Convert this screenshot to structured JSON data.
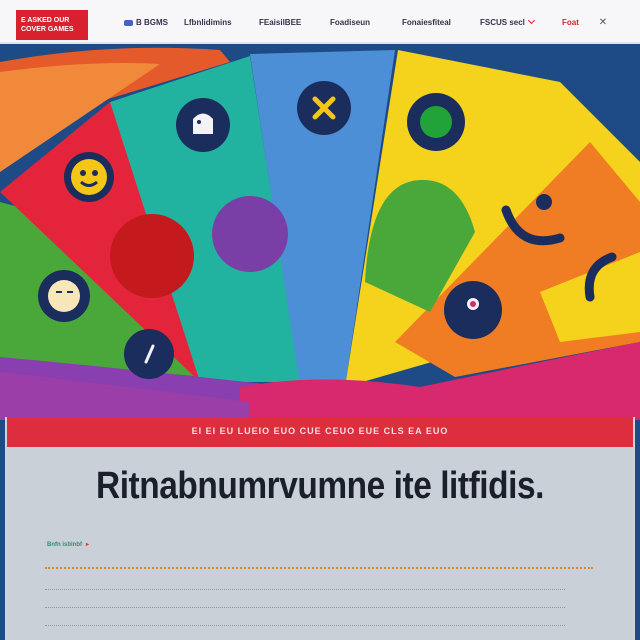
{
  "header": {
    "logo_text": "E ASKED OUR\nCOVER GAMES",
    "nav": [
      {
        "label": "B BGMS",
        "icon": "flag-icon"
      },
      {
        "label": "Lfbnlidimins"
      },
      {
        "label": "FEaisilBEE"
      },
      {
        "label": "Foadiseun"
      },
      {
        "label": "Fonaiesfiteal"
      },
      {
        "label": "FSCUS secl",
        "icon": "chevron-down-icon"
      },
      {
        "label": "Foat",
        "accent": true
      }
    ],
    "close_icon": "close-icon"
  },
  "hero": {
    "palette": {
      "red": "#e4243a",
      "teal": "#22b3a0",
      "blue": "#4d8fd6",
      "yellow": "#f5d31d",
      "green": "#4aa83a",
      "orange": "#f07d23",
      "magenta": "#d8286e",
      "purple": "#7a3fa6",
      "navy": "#1b2d5c"
    },
    "tokens": [
      "smiley-icon",
      "ghost-icon",
      "x-icon",
      "green-dot-icon",
      "sleepy-face-icon",
      "face-icon",
      "ball-icon",
      "smile-icon"
    ]
  },
  "card": {
    "kicker": "EI EI EU LUEIO EUO CUE CEUO EUE CLS EA EUO",
    "title": "Ritnabnumrvumne ite litfidis.",
    "meta": "Bnfn isblnbf",
    "meta_arrow": "▸"
  }
}
